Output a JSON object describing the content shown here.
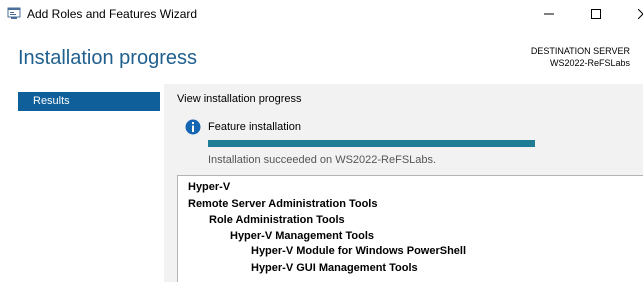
{
  "window": {
    "title": "Add Roles and Features Wizard"
  },
  "header": {
    "page_title": "Installation progress",
    "destination_label": "DESTINATION SERVER",
    "destination_server": "WS2022-ReFSLabs"
  },
  "sidebar": {
    "items": [
      {
        "label": "Results",
        "active": true
      }
    ]
  },
  "main": {
    "section_header": "View installation progress",
    "feature_label": "Feature installation",
    "progress_percent": 100,
    "status_text": "Installation succeeded on WS2022-ReFSLabs.",
    "results": [
      {
        "label": "Hyper-V",
        "level": 0
      },
      {
        "label": "Remote Server Administration Tools",
        "level": 0
      },
      {
        "label": "Role Administration Tools",
        "level": 1
      },
      {
        "label": "Hyper-V Management Tools",
        "level": 2
      },
      {
        "label": "Hyper-V Module for Windows PowerShell",
        "level": 3
      },
      {
        "label": "Hyper-V GUI Management Tools",
        "level": 3
      }
    ]
  },
  "colors": {
    "accent": "#0e5f9a",
    "title": "#1f5f8e",
    "progress": "#1e7c95",
    "info": "#1565b3"
  }
}
